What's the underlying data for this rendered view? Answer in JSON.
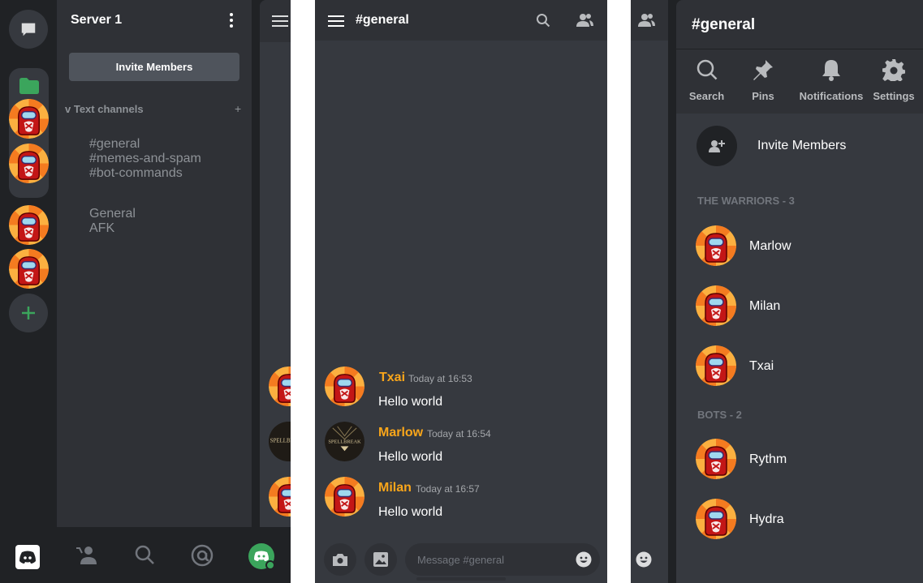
{
  "panel1": {
    "server_name": "Server 1",
    "invite_label": "Invite Members",
    "category_label": "v Text channels",
    "category_add": "+",
    "text_channels": [
      "#general",
      "#memes-and-spam",
      "#bot-commands"
    ],
    "voice_channels": [
      "General",
      "AFK"
    ]
  },
  "panel2": {
    "channel_title": "#general",
    "messages": [
      {
        "author": "Txai",
        "time": "Today at 16:53",
        "text": "Hello world",
        "avatar": "red-crewmate"
      },
      {
        "author": "Marlow",
        "time": "Today at 16:54",
        "text": "Hello world",
        "avatar": "spellbreak-logo"
      },
      {
        "author": "Milan",
        "time": "Today at 16:57",
        "text": "Hello world",
        "avatar": "red-crewmate"
      }
    ],
    "input_placeholder": "Message #general",
    "author_color": "#faa61a"
  },
  "spellbreak_text": "SPELLBREAK",
  "panel3": {
    "channel_title": "#general",
    "actions": [
      "Search",
      "Pins",
      "Notifications",
      "Settings"
    ],
    "invite_label": "Invite Members",
    "sections": [
      {
        "label": "THE WARRIORS - 3",
        "members": [
          "Marlow",
          "Milan",
          "Txai"
        ]
      },
      {
        "label": "BOTS - 2",
        "members": [
          "Rythm",
          "Hydra"
        ]
      }
    ]
  },
  "colors": {
    "rail_bg": "#202225",
    "panel_bg": "#2f3136",
    "chat_bg": "#36393f",
    "green": "#3ba55c"
  }
}
